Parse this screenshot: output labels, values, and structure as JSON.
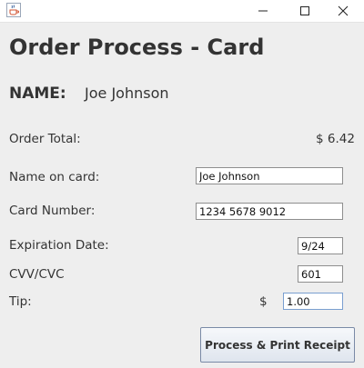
{
  "window": {
    "app_icon": "java-cup-icon",
    "minimize_icon": "minimize-icon",
    "maximize_icon": "maximize-icon",
    "close_icon": "close-icon"
  },
  "page": {
    "title": "Order Process - Card"
  },
  "customer": {
    "label": "NAME:",
    "value": "Joe Johnson"
  },
  "order_total": {
    "label": "Order Total:",
    "value": "$ 6.42"
  },
  "form": {
    "name_on_card": {
      "label": "Name on card:",
      "value": "Joe Johnson"
    },
    "card_number": {
      "label": "Card Number:",
      "value": "1234 5678 9012"
    },
    "expiration": {
      "label": "Expiration Date:",
      "value": "9/24"
    },
    "cvv": {
      "label": "CVV/CVC",
      "value": "601"
    },
    "tip": {
      "label": "Tip:",
      "currency": "$",
      "value": "1.00"
    }
  },
  "actions": {
    "process_label": "Process & Print Receipt"
  },
  "colors": {
    "background": "#eeeeee",
    "text": "#333333",
    "field_border": "#8e8e8e",
    "focused_field_border": "#7a9fd0"
  }
}
